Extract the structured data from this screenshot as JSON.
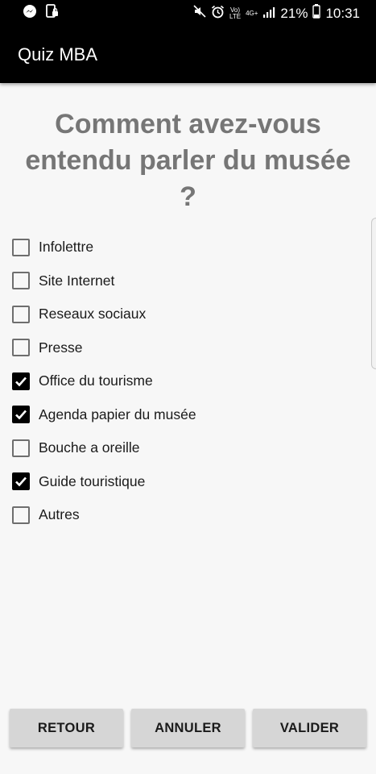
{
  "status_bar": {
    "battery_percent": "21%",
    "time": "10:31",
    "volte_top": "Vo)",
    "volte_bottom": "LTE",
    "network_top": "4G+",
    "icons": [
      "messenger-icon",
      "device-lock-icon",
      "mute-icon",
      "alarm-icon",
      "volte-icon",
      "signal-icon",
      "battery-icon"
    ]
  },
  "app_bar": {
    "title": "Quiz MBA"
  },
  "question": "Comment avez-vous entendu parler du musée ?",
  "options": [
    {
      "label": "Infolettre",
      "checked": false
    },
    {
      "label": "Site Internet",
      "checked": false
    },
    {
      "label": "Reseaux sociaux",
      "checked": false
    },
    {
      "label": "Presse",
      "checked": false
    },
    {
      "label": "Office du tourisme",
      "checked": true
    },
    {
      "label": "Agenda papier du musée",
      "checked": true
    },
    {
      "label": "Bouche a oreille",
      "checked": false
    },
    {
      "label": "Guide touristique",
      "checked": true
    },
    {
      "label": "Autres",
      "checked": false
    }
  ],
  "buttons": {
    "back": "RETOUR",
    "cancel": "ANNULER",
    "submit": "VALIDER"
  },
  "colors": {
    "bar_background": "#000000",
    "question_text": "#767676",
    "button_background": "#d6d6d6",
    "checkbox_checked": "#000000"
  }
}
